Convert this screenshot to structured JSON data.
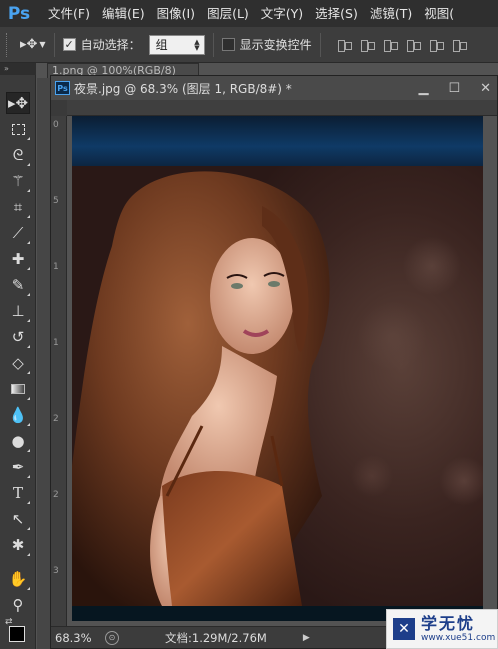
{
  "app": {
    "logo": "Ps"
  },
  "menu": {
    "items": [
      "文件(F)",
      "编辑(E)",
      "图像(I)",
      "图层(L)",
      "文字(Y)",
      "选择(S)",
      "滤镜(T)",
      "视图("
    ]
  },
  "options": {
    "auto_select_label": "自动选择：",
    "auto_select_checked": true,
    "auto_select_value": "组",
    "show_transform_label": "显示变换控件",
    "show_transform_checked": false
  },
  "toolbox": {
    "header": "»",
    "tools": [
      "move-tool",
      "marquee-tool",
      "lasso-tool",
      "magic-wand-tool",
      "crop-tool",
      "eyedropper-tool",
      "healing-brush-tool",
      "brush-tool",
      "clone-stamp-tool",
      "history-brush-tool",
      "eraser-tool",
      "gradient-tool",
      "blur-tool",
      "dodge-tool",
      "pen-tool",
      "type-tool",
      "path-selection-tool",
      "custom-shape-tool",
      "hand-tool",
      "zoom-tool"
    ],
    "foreground_color": "#000000"
  },
  "documents": {
    "back_tab": "1.png @ 100%(RGB/8)",
    "active_title": "夜景.jpg @ 68.3% (图层 1, RGB/8#) *",
    "ruler_left_marks": [
      "0",
      "5",
      "1",
      "1",
      "2",
      "2",
      "3"
    ]
  },
  "status": {
    "zoom": "68.3%",
    "doc_info": "文档:1.29M/2.76M",
    "arrow": "▶"
  },
  "watermark": {
    "name": "学无忧",
    "url": "www.xue51.com"
  }
}
